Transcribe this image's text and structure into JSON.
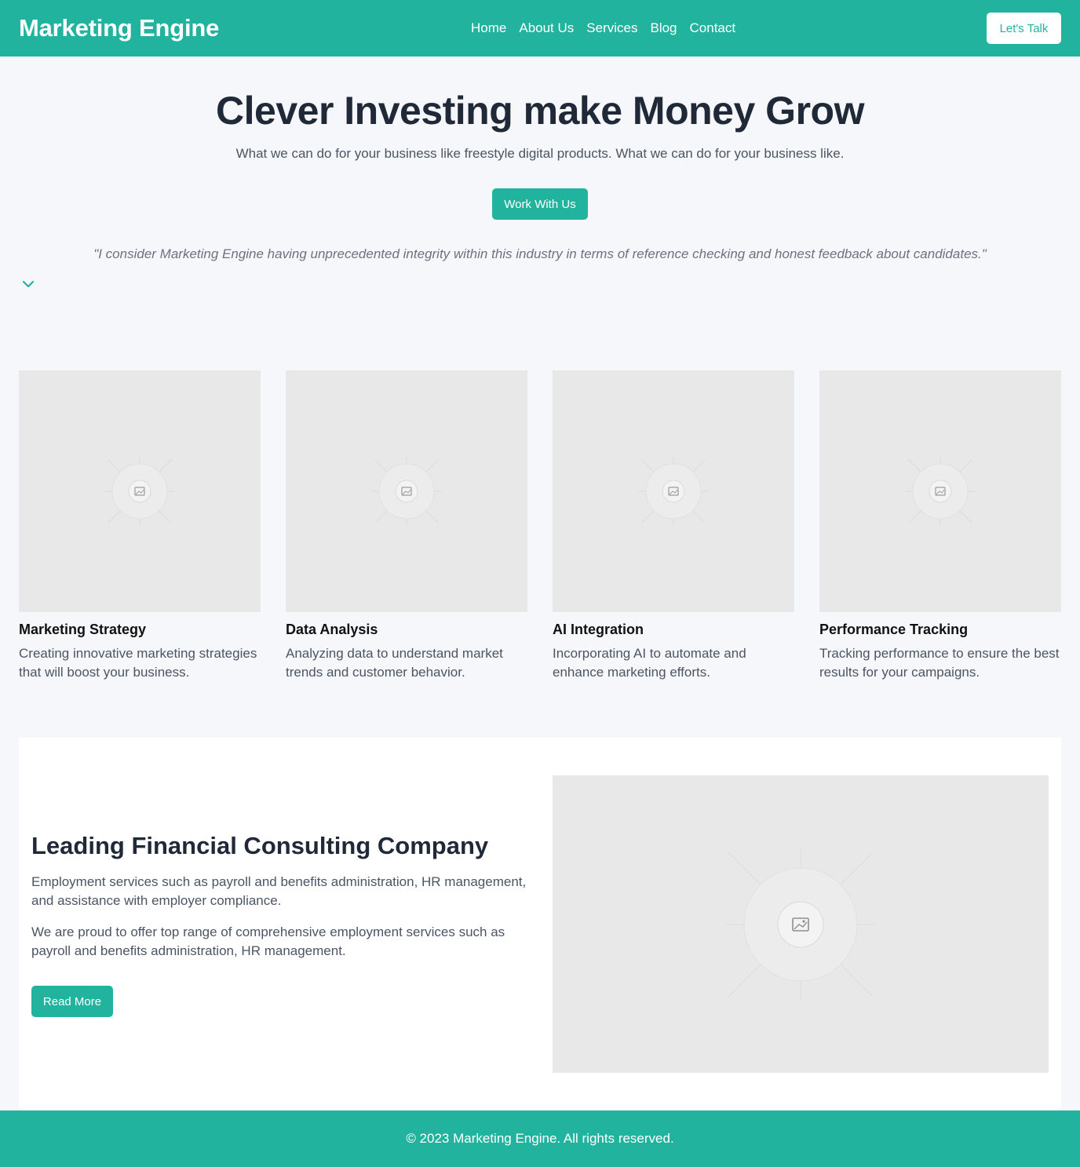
{
  "header": {
    "brand": "Marketing Engine",
    "nav": [
      "Home",
      "About Us",
      "Services",
      "Blog",
      "Contact"
    ],
    "cta_label": "Let's Talk"
  },
  "hero": {
    "title": "Clever Investing make Money Grow",
    "subtitle": "What we can do for your business like freestyle digital products. What we can do for your business like.",
    "cta_label": "Work With Us",
    "quote": "\"I consider Marketing Engine having unprecedented integrity within this industry in terms of reference checking and honest feedback about candidates.\"",
    "scroll_icon": "chevron-down-icon"
  },
  "services": [
    {
      "title": "Marketing Strategy",
      "description": "Creating innovative marketing strategies that will boost your business."
    },
    {
      "title": "Data Analysis",
      "description": "Analyzing data to understand market trends and customer behavior."
    },
    {
      "title": "AI Integration",
      "description": "Incorporating AI to automate and enhance marketing efforts."
    },
    {
      "title": "Performance Tracking",
      "description": "Tracking performance to ensure the best results for your campaigns."
    }
  ],
  "feature": {
    "title": "Leading Financial Consulting Company",
    "paragraph1": "Employment services such as payroll and benefits administration, HR management, and assistance with employer compliance.",
    "paragraph2": "We are proud to offer top range of comprehensive employment services such as payroll and benefits administration, HR management.",
    "cta_label": "Read More",
    "image_icon": "image-placeholder-icon"
  },
  "footer": {
    "copyright": "© 2023 Marketing Engine. All rights reserved."
  },
  "colors": {
    "accent": "#22b39f",
    "background": "#f6f7fa",
    "placeholder": "#e8e8e8",
    "heading": "#1f2937",
    "body_text": "#4b5563"
  }
}
